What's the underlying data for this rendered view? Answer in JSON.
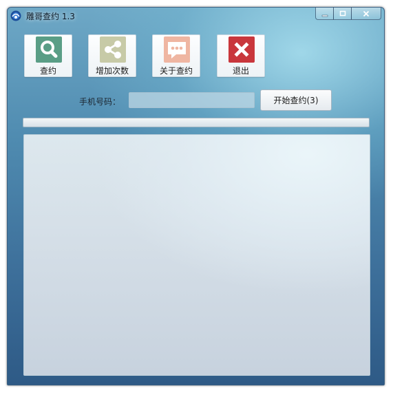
{
  "window": {
    "title": "雕哥查约 1.3"
  },
  "toolbar": [
    {
      "label": "查约",
      "icon": "search-icon",
      "color": "#5a9e86"
    },
    {
      "label": "增加次数",
      "icon": "share-icon",
      "color": "#c7caa7"
    },
    {
      "label": "关于查约",
      "icon": "chat-bubble-icon",
      "color": "#efb6a2"
    },
    {
      "label": "退出",
      "icon": "close-x-icon",
      "color": "#c9373c"
    }
  ],
  "form": {
    "phone_label": "手机号码：",
    "phone_value": "",
    "start_button_label": "开始查约(3)"
  },
  "progress": {
    "fraction": 0
  },
  "log": {
    "content": ""
  }
}
